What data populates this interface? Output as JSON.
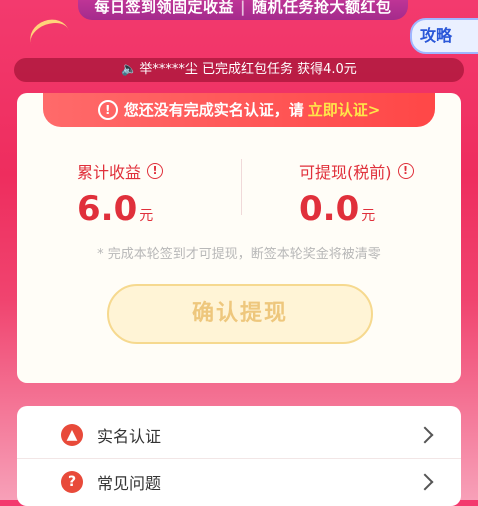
{
  "banner": {
    "left_text": "每日签到领固定收益",
    "separator": "|",
    "right_text": "随机任务抢大额红包"
  },
  "guide_tab": {
    "label": "攻略"
  },
  "ticker": {
    "text": "举*****尘 已完成红包任务 获得4.0元"
  },
  "alert": {
    "text": "您还没有完成实名认证，请",
    "link_text": "立即认证>"
  },
  "stats": {
    "earned": {
      "label": "累计收益",
      "value": "6.0",
      "unit": "元"
    },
    "withdrawable": {
      "label": "可提现(税前)",
      "value": "0.0",
      "unit": "元"
    }
  },
  "notice": "* 完成本轮签到才可提现，断签本轮奖金将被清零",
  "confirm_button": {
    "label": "确认提现"
  },
  "menu": [
    {
      "label": "实名认证",
      "icon": "id-verify-icon"
    },
    {
      "label": "常见问题",
      "icon": "question-icon"
    }
  ]
}
